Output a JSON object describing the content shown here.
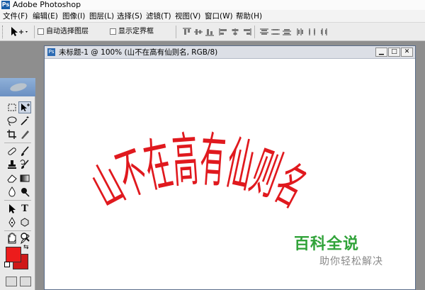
{
  "app": {
    "title": "Adobe Photoshop",
    "logo_icon": "photoshop-logo-icon"
  },
  "menu": [
    "文件(F)",
    "编辑(E)",
    "图像(I)",
    "图层(L)",
    "选择(S)",
    "滤镜(T)",
    "视图(V)",
    "窗口(W)",
    "帮助(H)"
  ],
  "options": {
    "tool_icon": "move-tool-icon",
    "auto_select_label": "自动选择图层",
    "auto_select_checked": false,
    "show_bounds_label": "显示定界框",
    "show_bounds_checked": false,
    "align_icons": [
      "align-top-icon",
      "align-vcenter-icon",
      "align-bottom-icon",
      "align-left-icon",
      "align-hcenter-icon",
      "align-right-icon"
    ],
    "distribute_icons": [
      "distribute-top-icon",
      "distribute-vcenter-icon",
      "distribute-bottom-icon",
      "distribute-left-icon",
      "distribute-hcenter-icon",
      "distribute-right-icon"
    ]
  },
  "document": {
    "title": "未标题-1 @ 100% (山不在高有仙则名, RGB/8)",
    "warped_text": "山不在高有仙则名",
    "text_color": "#e0191e",
    "window_buttons": [
      "minimize-icon",
      "maximize-icon",
      "close-icon"
    ]
  },
  "toolbox": {
    "foreground_color": "#ec1c1c",
    "background_color": "#cf1919"
  },
  "watermark": {
    "brand": "百科全说",
    "tagline": "助你轻松解决",
    "brand_color": "#31a33a"
  }
}
